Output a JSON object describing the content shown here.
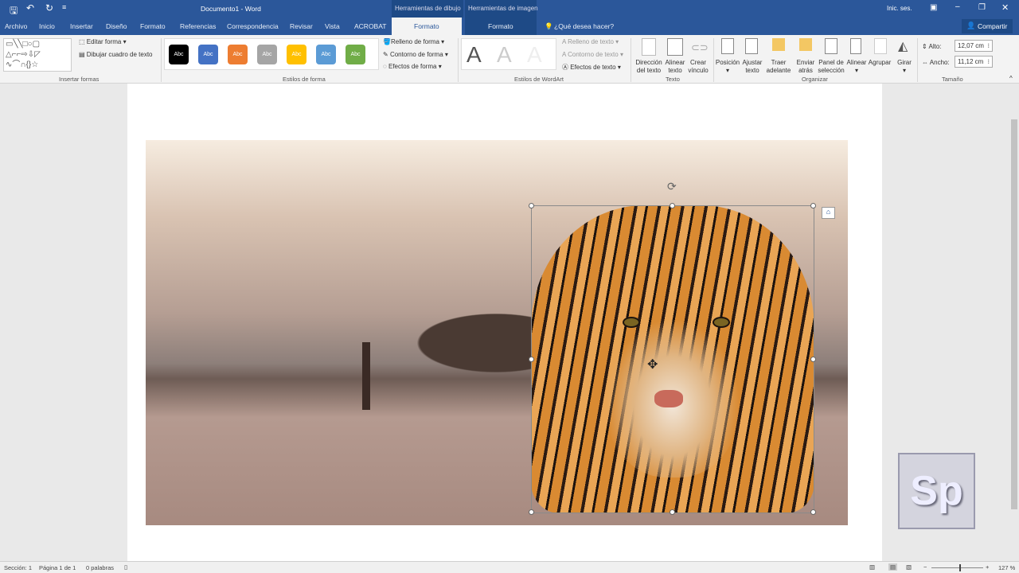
{
  "title_bar": {
    "doc_title": "Documento1 - Word",
    "context_drawing": "Herramientas de dibujo",
    "context_image": "Herramientas de imagen",
    "signin": "Inic. ses."
  },
  "tabs": [
    "Archivo",
    "Inicio",
    "Insertar",
    "Diseño",
    "Formato",
    "Referencias",
    "Correspondencia",
    "Revisar",
    "Vista",
    "ACROBAT",
    "Formato",
    "Formato"
  ],
  "tell_me": "¿Qué desea hacer?",
  "share": "Compartir",
  "ribbon": {
    "insert_shapes": {
      "edit_shape": "Editar forma",
      "draw_textbox": "Dibujar cuadro de texto",
      "label": "Insertar formas"
    },
    "shape_styles": {
      "swatches": [
        {
          "text": "Abc",
          "color": "#000000"
        },
        {
          "text": "Abc",
          "color": "#4472c4"
        },
        {
          "text": "Abc",
          "color": "#ed7d31"
        },
        {
          "text": "Abc",
          "color": "#a5a5a5"
        },
        {
          "text": "Abc",
          "color": "#ffc000"
        },
        {
          "text": "Abc",
          "color": "#5b9bd5"
        },
        {
          "text": "Abc",
          "color": "#70ad47"
        }
      ],
      "fill": "Relleno de forma",
      "outline": "Contorno de forma",
      "effects": "Efectos de forma",
      "label": "Estilos de forma"
    },
    "wordart": {
      "letter": "A",
      "text_fill": "Relleno de texto",
      "text_outline": "Contorno de texto",
      "text_effects": "Efectos de texto",
      "label": "Estilos de WordArt"
    },
    "text": {
      "direction": [
        "Dirección",
        "del texto"
      ],
      "align": [
        "Alinear",
        "texto"
      ],
      "link": [
        "Crear",
        "vínculo"
      ],
      "label": "Texto"
    },
    "arrange": {
      "position": "Posición",
      "wrap": [
        "Ajustar",
        "texto"
      ],
      "forward": [
        "Traer",
        "adelante"
      ],
      "backward": [
        "Enviar",
        "atrás"
      ],
      "pane": [
        "Panel de",
        "selección"
      ],
      "align": "Alinear",
      "group": "Agrupar",
      "rotate": "Girar",
      "label": "Organizar"
    },
    "size": {
      "height_label": "Alto:",
      "height": "12,07 cm",
      "width_label": "Ancho:",
      "width": "11,12 cm",
      "label": "Tamaño"
    }
  },
  "status": {
    "section": "Sección: 1",
    "page": "Página 1 de 1",
    "words": "0 palabras",
    "zoom": "127 %",
    "zoom_level": 127
  },
  "logo": "Sp"
}
